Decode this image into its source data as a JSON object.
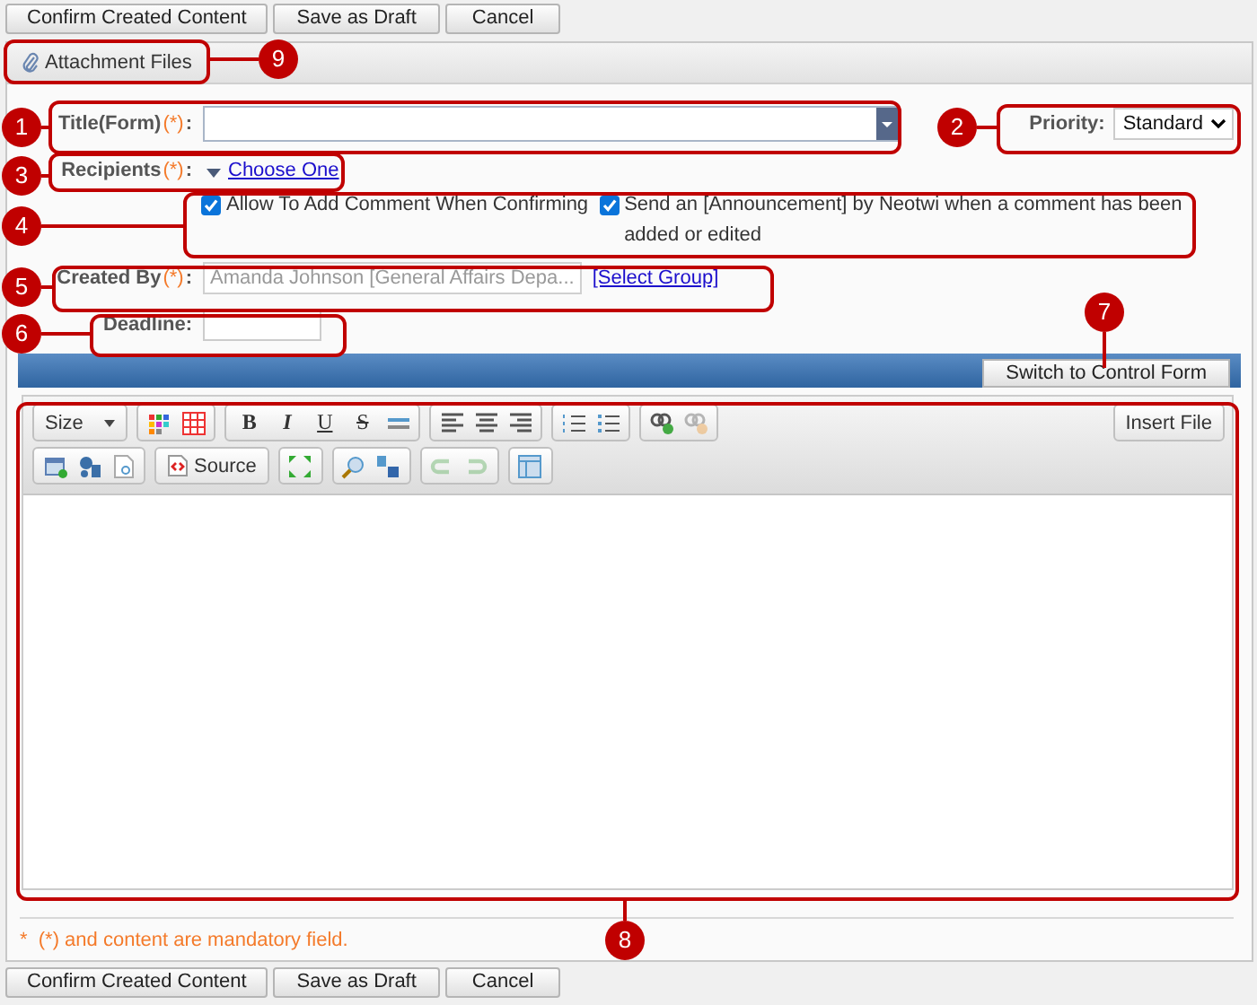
{
  "top_buttons": [
    "Confirm Created Content",
    "Save as Draft",
    "Cancel"
  ],
  "attachment_tab": {
    "label": "Attachment Files"
  },
  "title_field": {
    "label": "Title(Form)",
    "mark": "(*)",
    "separator": ":"
  },
  "priority": {
    "label": "Priority",
    "separator": ":",
    "value": "Standard"
  },
  "recipients": {
    "label": "Recipients",
    "mark": "(*)",
    "separator": ":",
    "link": "Choose One"
  },
  "options": [
    {
      "label": "Allow To Add Comment When Confirming",
      "checked": true
    },
    {
      "label": "Send an [Announcement] by Neotwi when a comment has been added or edited",
      "checked": true
    }
  ],
  "created_by": {
    "label": "Created By",
    "mark": "(*)",
    "separator": ":",
    "value": "Amanda Johnson [General Affairs Depa...",
    "link": "[Select Group]"
  },
  "deadline": {
    "label": "Deadline",
    "separator": ":"
  },
  "switch_button": "Switch to Control Form",
  "editor": {
    "toolbar_rows": [
      [
        [
          {
            "kind": "dropdown",
            "label": "Size"
          }
        ],
        [
          {
            "kind": "icon",
            "disabled": false
          },
          {
            "kind": "icon",
            "disabled": false
          }
        ],
        [
          {
            "kind": "glyph",
            "label": "B"
          },
          {
            "kind": "glyph",
            "label": "I"
          },
          {
            "kind": "glyph",
            "label": "U"
          },
          {
            "kind": "glyph",
            "label": "S"
          },
          {
            "kind": "icon",
            "disabled": false
          }
        ],
        [
          {
            "kind": "icon",
            "disabled": false
          },
          {
            "kind": "icon",
            "disabled": false
          },
          {
            "kind": "icon",
            "disabled": false
          }
        ],
        [
          {
            "kind": "icon",
            "disabled": false
          },
          {
            "kind": "icon",
            "disabled": false
          }
        ],
        [
          {
            "kind": "icon",
            "disabled": false
          },
          {
            "kind": "icon",
            "disabled": true
          }
        ]
      ],
      [
        [
          {
            "kind": "icon",
            "disabled": false
          },
          {
            "kind": "icon",
            "disabled": false
          },
          {
            "kind": "icon",
            "disabled": false
          }
        ],
        [
          {
            "kind": "source",
            "label": "Source"
          }
        ],
        [
          {
            "kind": "icon",
            "disabled": false
          }
        ],
        [
          {
            "kind": "icon",
            "disabled": false
          },
          {
            "kind": "icon",
            "disabled": false
          }
        ],
        [
          {
            "kind": "icon",
            "disabled": true
          },
          {
            "kind": "icon",
            "disabled": true
          }
        ],
        [
          {
            "kind": "icon",
            "disabled": false
          }
        ]
      ]
    ],
    "insert_file": "Insert File"
  },
  "note": {
    "star": "*",
    "text": "(*)  and content are mandatory field."
  },
  "bottom_buttons": [
    "Confirm Created Content",
    "Save as Draft",
    "Cancel"
  ],
  "callouts": [
    {
      "number": "1"
    },
    {
      "number": "2"
    },
    {
      "number": "3"
    },
    {
      "number": "4"
    },
    {
      "number": "5"
    },
    {
      "number": "6"
    },
    {
      "number": "7"
    },
    {
      "number": "8"
    },
    {
      "number": "9"
    }
  ]
}
